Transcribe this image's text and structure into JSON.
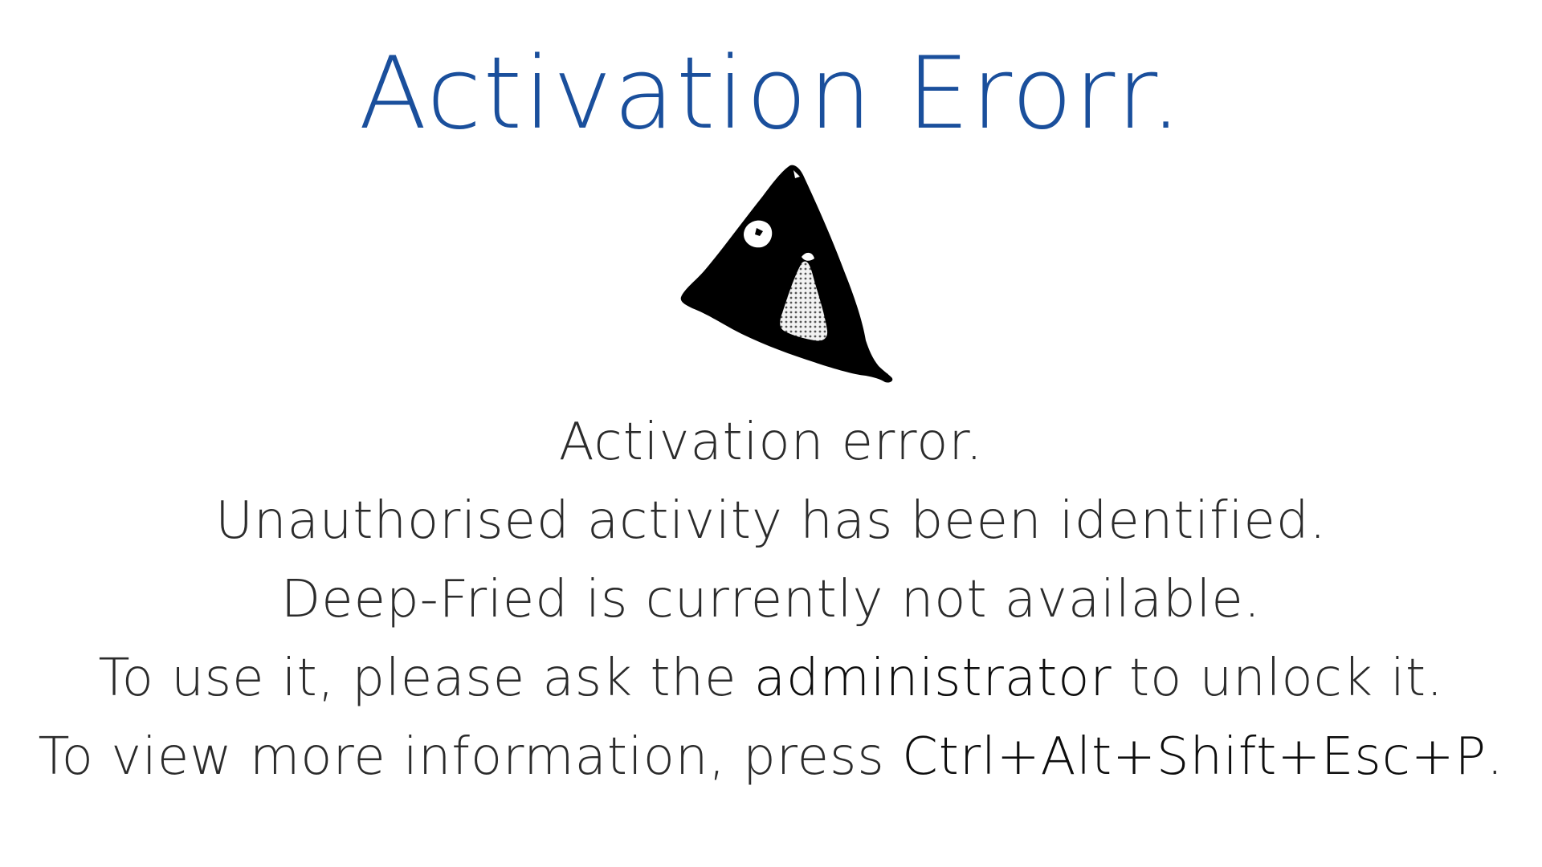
{
  "title": "Activation Erorr.",
  "warning_icon": "deep-fried-warning-triangle-icon",
  "colors": {
    "title": "#1a4f9c",
    "body_text": "#2b2b2b",
    "emphasis_text": "#0d0d0d",
    "icon": "#000000",
    "background": "#ffffff"
  },
  "message": {
    "line1": "Activation error.",
    "line2": "Unauthorised activity has been identified.",
    "line3": "Deep-Fried is currently not available.",
    "line4": {
      "before": "To use it, please ask the ",
      "highlight": "administrator",
      "after": " to unlock it."
    },
    "line5": {
      "before": "To view more information, press ",
      "highlight": "Ctrl+Alt+Shift+Esc+P",
      "after": "."
    }
  }
}
